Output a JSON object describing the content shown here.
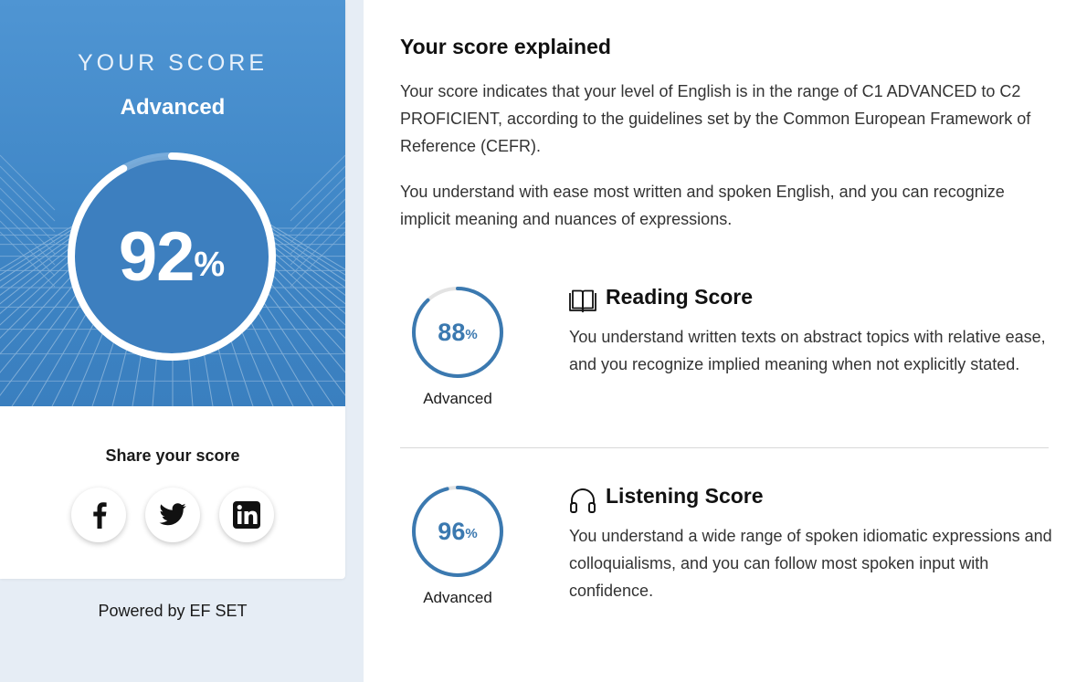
{
  "overall": {
    "heading": "YOUR SCORE",
    "level": "Advanced",
    "score": 92,
    "score_text": "92",
    "percent_sign": "%"
  },
  "share": {
    "title": "Share your score",
    "buttons": [
      {
        "network": "facebook",
        "icon": "facebook-icon"
      },
      {
        "network": "twitter",
        "icon": "twitter-icon"
      },
      {
        "network": "linkedin",
        "icon": "linkedin-icon"
      }
    ]
  },
  "footer": {
    "powered_by": "Powered by EF SET"
  },
  "explanation": {
    "title": "Your score explained",
    "paragraph1": "Your score indicates that your level of English is in the range of C1 ADVANCED to C2 PROFICIENT, according to the guidelines set by the Common European Framework of Reference (CEFR).",
    "paragraph2": "You understand with ease most written and spoken English, and you can recognize implicit meaning and nuances of expressions."
  },
  "sections": {
    "reading": {
      "title": "Reading Score",
      "icon": "open-book-icon",
      "score": 88,
      "score_text": "88",
      "percent_sign": "%",
      "level": "Advanced",
      "description": "You understand written texts on abstract topics with relative ease, and you recognize implied meaning when not explicitly stated."
    },
    "listening": {
      "title": "Listening Score",
      "icon": "headphones-icon",
      "score": 96,
      "score_text": "96",
      "percent_sign": "%",
      "level": "Advanced",
      "description": "You understand a wide range of spoken idiomatic expressions and colloquialisms, and you can follow most spoken input with confidence."
    }
  },
  "colors": {
    "hero_blue": "#4a8fd0",
    "gauge_blue": "#3b79b0",
    "gauge_track": "#e3e3e3",
    "background": "#e6edf5"
  }
}
